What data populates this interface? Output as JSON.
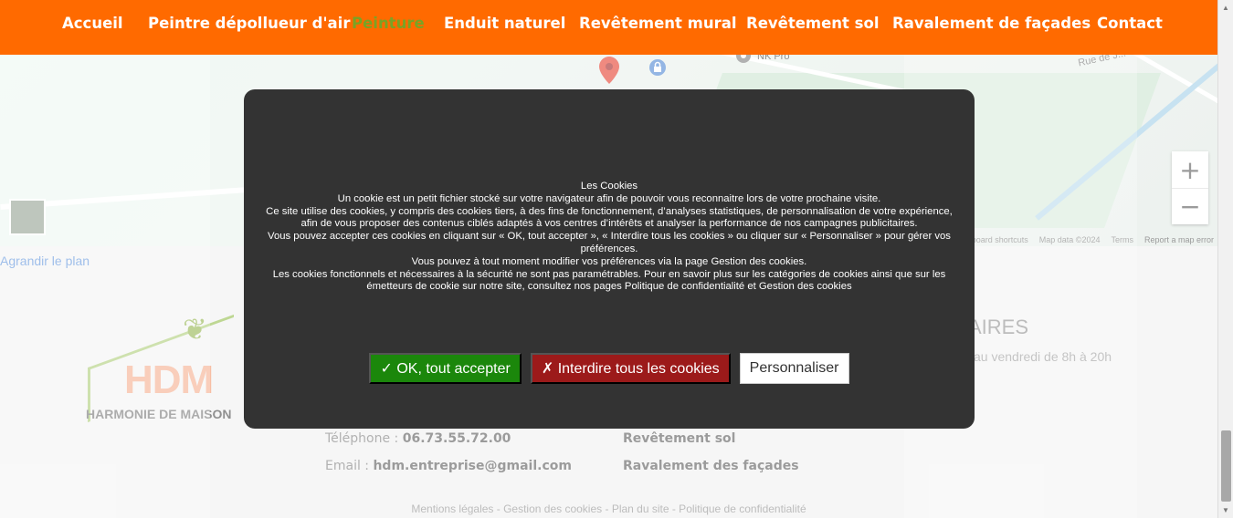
{
  "nav": {
    "items": [
      {
        "label": "Accueil"
      },
      {
        "label": "Peintre dépollueur d'air"
      },
      {
        "label": "Peinture"
      },
      {
        "label": "Enduit naturel"
      },
      {
        "label": "Revêtement mural"
      },
      {
        "label": "Revêtement sol"
      },
      {
        "label": "Ravalement de façades"
      },
      {
        "label": "Contact"
      }
    ],
    "active": "Peinture",
    "colors": {
      "bar": "#ff6a00",
      "active": "#7aa325"
    }
  },
  "map": {
    "poi": "NK Pro",
    "street": "Rue de J...",
    "zoom_in": "+",
    "zoom_out": "−",
    "attribution": {
      "shortcuts": "Keyboard shortcuts",
      "data": "Map data ©2024",
      "terms": "Terms",
      "report": "Report a map error"
    },
    "enlarge_link": "Agrandir le plan"
  },
  "footer": {
    "logo_text": "HDM",
    "logo_subtitle": "HARMONIE DE MAISON",
    "phone_label": "Téléphone :",
    "phone": "06.73.55.72.00",
    "email_label": "Email :",
    "email": "hdm.entreprise@gmail.com",
    "services": [
      "Revêtement sol",
      "Ravalement des façades"
    ],
    "hours_title": "AIRES",
    "hours_text": "au vendredi de 8h à 20h",
    "legal": "Mentions légales - Gestion des cookies - Plan du site - Politique de confidentialité"
  },
  "cookie_modal": {
    "title": "Les Cookies",
    "paragraphs": [
      "Un cookie est un petit fichier stocké sur votre navigateur afin de pouvoir vous reconnaitre lors de votre prochaine visite.",
      "Ce site utilise des cookies, y compris des cookies tiers, à des fins de fonctionnement, d’analyses statistiques, de personnalisation de votre expérience, afin de vous proposer des contenus ciblés adaptés à vos centres d’intérêts et analyser la performance de nos campagnes publicitaires.",
      "Vous pouvez accepter ces cookies en cliquant sur « OK, tout accepter », «  Interdire tous les cookies  » ou cliquer sur « Personnaliser » pour gérer vos préférences.",
      "Vous pouvez à tout moment modifier vos préférences via la page Gestion des cookies.",
      "Les cookies fonctionnels et nécessaires à la sécurité ne sont pas paramétrables. Pour en savoir plus sur les catégories de cookies ainsi que sur les émetteurs de cookie sur notre site, consultez nos pages Politique de confidentialité et Gestion des cookies"
    ],
    "accept_label": "✓ OK, tout accepter",
    "deny_label": "✗ Interdire tous les cookies",
    "customize_label": "Personnaliser",
    "colors": {
      "background": "#333333",
      "accept": "#1b870b",
      "deny": "#9c1a1a"
    }
  }
}
